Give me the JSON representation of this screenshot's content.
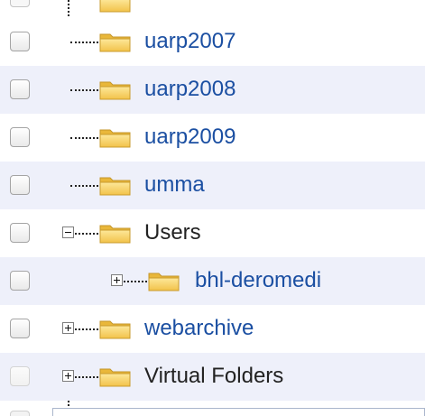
{
  "tree": {
    "rows": [
      {
        "label": "uarp2007",
        "icon": "folder-icon",
        "expander": "none",
        "style": "link"
      },
      {
        "label": "uarp2008",
        "icon": "folder-icon",
        "expander": "none",
        "style": "link"
      },
      {
        "label": "uarp2009",
        "icon": "folder-icon",
        "expander": "none",
        "style": "link"
      },
      {
        "label": "umma",
        "icon": "folder-icon",
        "expander": "none",
        "style": "link"
      },
      {
        "label": "Users",
        "icon": "folder-icon",
        "expander": "minus",
        "style": "dark"
      },
      {
        "label": "bhl-deromedi",
        "icon": "folder-icon",
        "expander": "plus",
        "style": "link"
      },
      {
        "label": "webarchive",
        "icon": "folder-icon",
        "expander": "plus",
        "style": "link"
      },
      {
        "label": "Virtual Folders",
        "icon": "folder-icon",
        "expander": "plus",
        "style": "dark"
      }
    ]
  },
  "colors": {
    "link_text": "#1b4fa2",
    "dark_text": "#222222",
    "alt_row": "#eef0fa",
    "folder_fill": "#f7d35e"
  }
}
